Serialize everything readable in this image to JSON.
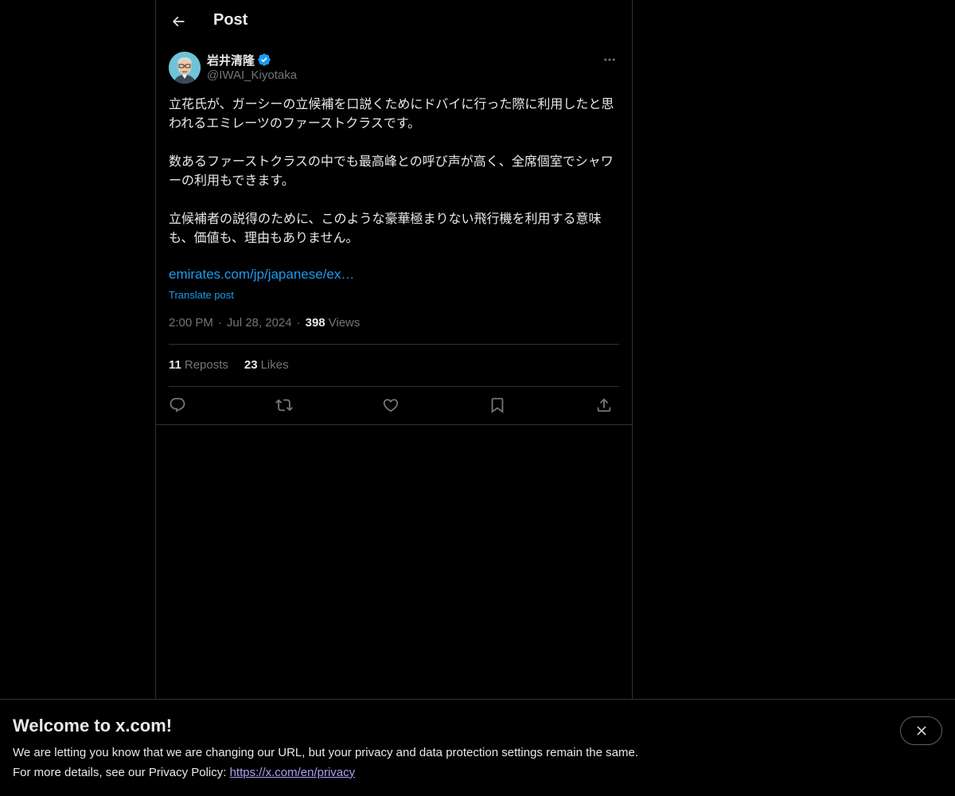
{
  "header": {
    "title": "Post"
  },
  "author": {
    "display_name": "岩井清隆",
    "handle": "@IWAI_Kiyotaka",
    "verified": true
  },
  "tweet": {
    "paragraphs": [
      "立花氏が、ガーシーの立候補を口説くためにドバイに行った際に利用したと思われるエミレーツのファーストクラスです。",
      "数あるファーストクラスの中でも最高峰との呼び声が高く、全席個室でシャワーの利用もできます。",
      "立候補者の説得のために、このような豪華極まりない飛行機を利用する意味も、価値も、理由もありません。"
    ],
    "link_text": "emirates.com/jp/japanese/ex…",
    "translate_label": "Translate post",
    "time": "2:00 PM",
    "date": "Jul 28, 2024",
    "views_count": "398",
    "views_label": "Views"
  },
  "stats": {
    "reposts_count": "11",
    "reposts_label": "Reposts",
    "likes_count": "23",
    "likes_label": "Likes"
  },
  "actions": [
    "reply-icon",
    "repost-icon",
    "like-icon",
    "bookmark-icon",
    "share-icon"
  ],
  "banner": {
    "title": "Welcome to x.com!",
    "line1": "We are letting you know that we are changing our URL, but your privacy and data protection settings remain the same.",
    "line2_prefix": "For more details, see our Privacy Policy: ",
    "link": "https://x.com/en/privacy"
  },
  "colors": {
    "background": "#000000",
    "text": "#e7e9ea",
    "muted": "#71767b",
    "accent": "#1d9bf0",
    "border": "#2f3336",
    "verified": "#1d9bf0",
    "privacy_link": "#a9a0f2"
  }
}
